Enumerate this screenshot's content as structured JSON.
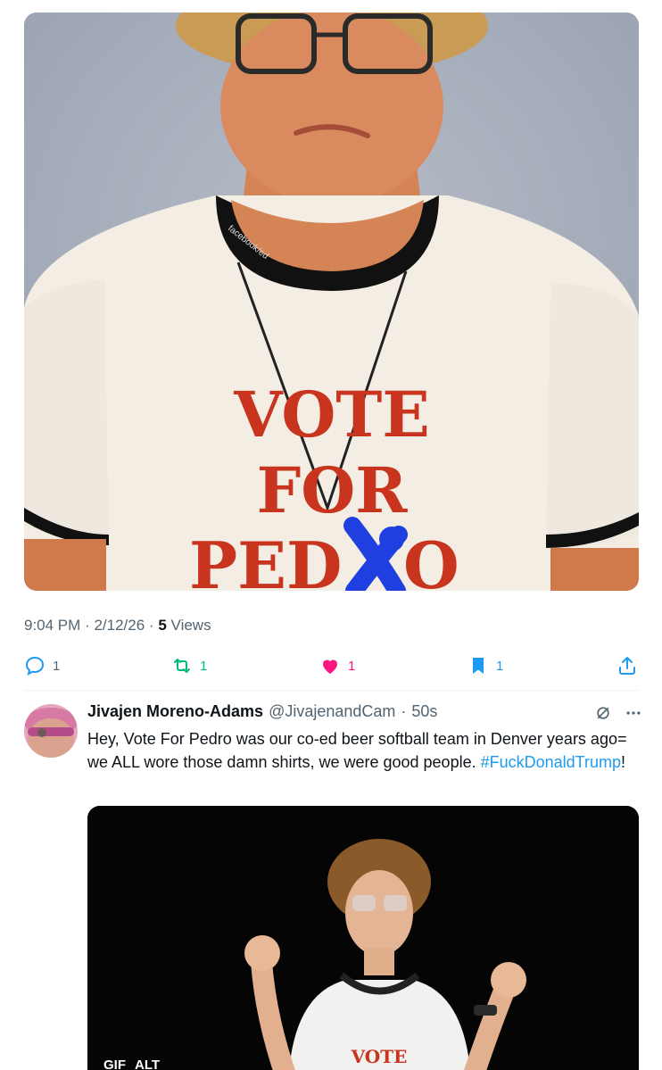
{
  "post": {
    "image": {
      "alt": "",
      "shirt_line1": "VOTE",
      "shirt_line2": "FOR",
      "shirt_line3_a": "PED",
      "shirt_line3_b": "O",
      "collar_text": "facebook/ed",
      "colors": {
        "background": "#a9b0bd",
        "shirt": "#f3ede4",
        "letters": "#c8341e",
        "cross": "#1f3fe0",
        "trim": "#111111",
        "skin": "#d98a5e",
        "hair": "#c99b55"
      }
    },
    "time": "9:04 PM",
    "date": "2/12/26",
    "sep": "·",
    "views_count": "5",
    "views_label": "Views",
    "reply_count": "1",
    "retweet_count": "1",
    "like_count": "1",
    "bookmark_count": "1"
  },
  "reply": {
    "name": "Jivajen Moreno-Adams",
    "handle": "@JivajenandCam",
    "sep": "·",
    "time": "50s",
    "text_before": "Hey, Vote For Pedro was our co-ed beer softball team in Denver years ago= we ALL wore those damn shirts, we were good people. ",
    "hashtag": "#FuckDonaldTrump",
    "text_after": "!",
    "gif": {
      "badge_gif": "GIF",
      "badge_alt": "ALT",
      "shirt_text": "VOTE"
    }
  },
  "icons": {
    "reply": "reply-icon",
    "retweet": "retweet-icon",
    "like": "heart-icon",
    "bookmark": "bookmark-icon",
    "share": "share-icon",
    "grok": "grok-icon",
    "more": "more-icon"
  }
}
